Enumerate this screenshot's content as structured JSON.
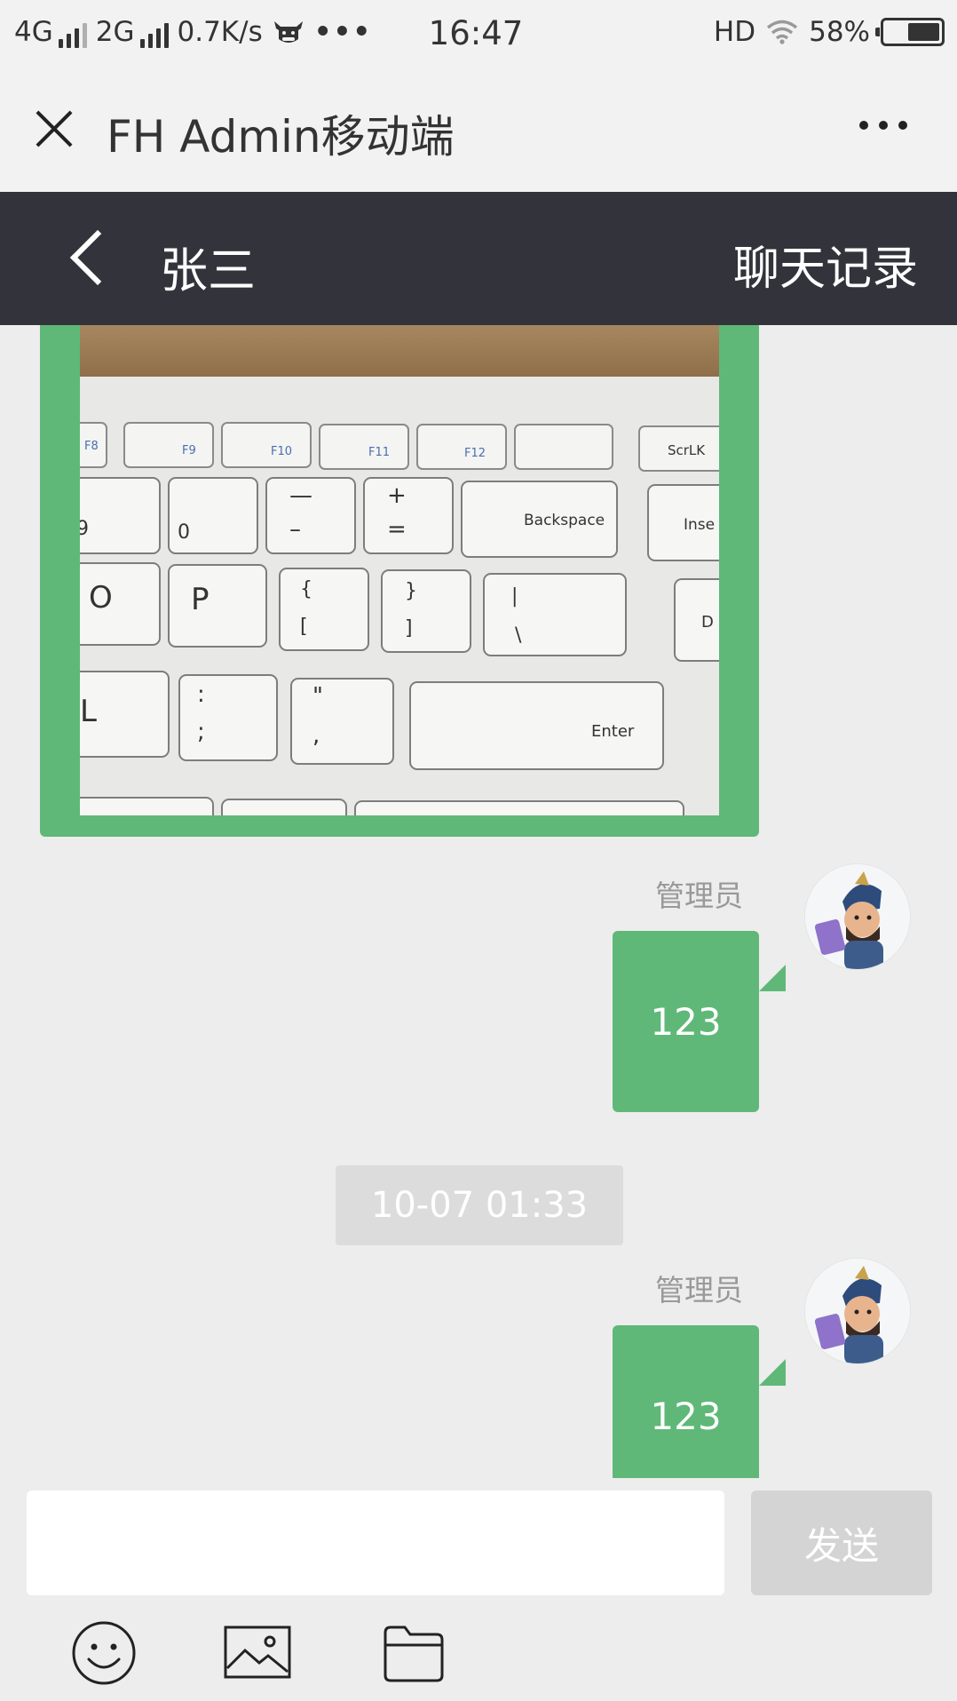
{
  "status_bar": {
    "network_1": "4G",
    "network_2": "2G",
    "speed": "0.7K/s",
    "more": "•••",
    "time": "16:47",
    "hd": "HD",
    "battery": "58%",
    "battery_level": 0.58
  },
  "title_bar": {
    "title": "FH Admin移动端"
  },
  "chat_header": {
    "contact_name": "张三",
    "history_label": "聊天记录"
  },
  "photo": {
    "keys": [
      "F8",
      "F9",
      "F10",
      "F11",
      "F12",
      "ScrLK",
      "Backspace",
      "Inse",
      "O",
      "P",
      "L",
      "Enter",
      "D",
      "0",
      "9"
    ]
  },
  "messages": [
    {
      "sender": "管理员",
      "text": "123"
    },
    {
      "sender": "管理员",
      "text": "123"
    }
  ],
  "timestamp": "10-07 01:33",
  "composer": {
    "input_value": "",
    "send_label": "发送"
  },
  "colors": {
    "bubble_green": "#5fb878",
    "header_dark": "#32333b"
  },
  "icons": [
    "close-icon",
    "more-icon",
    "back-icon",
    "emoji-icon",
    "image-icon",
    "folder-icon"
  ]
}
